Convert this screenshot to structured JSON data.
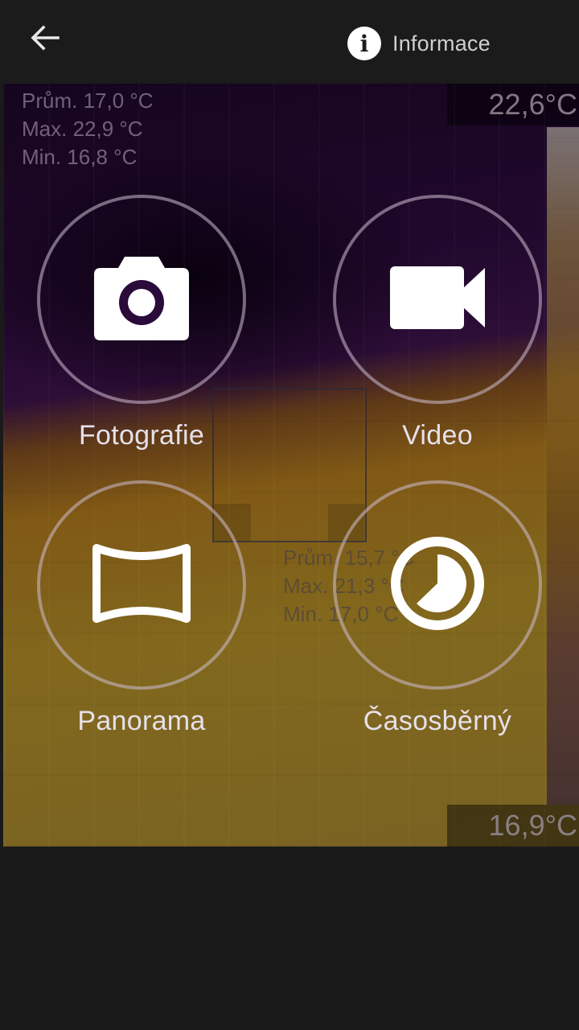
{
  "header": {
    "back_icon": "arrow-left-icon",
    "info_icon": "info-icon",
    "info_label": "Informace"
  },
  "thermal": {
    "stats_full": [
      "Prům. 17,0 °C",
      "Max. 22,9 °C",
      "Min. 16,8 °C"
    ],
    "stats_spot": [
      "Prům. 15,7 °C",
      "Max. 21,3 °C",
      "Min. 17,0 °C"
    ],
    "scale_max": "22,6°C",
    "scale_min": "16,9°C"
  },
  "modes": [
    {
      "label": "Fotografie",
      "icon": "camera-icon"
    },
    {
      "label": "Video",
      "icon": "video-camera-icon"
    },
    {
      "label": "Panorama",
      "icon": "panorama-icon"
    },
    {
      "label": "Časosběrný",
      "icon": "timelapse-icon"
    }
  ],
  "colors": {
    "background": "#1a1a1a",
    "ring": "#cdbed2",
    "label": "#e6e0ea"
  }
}
